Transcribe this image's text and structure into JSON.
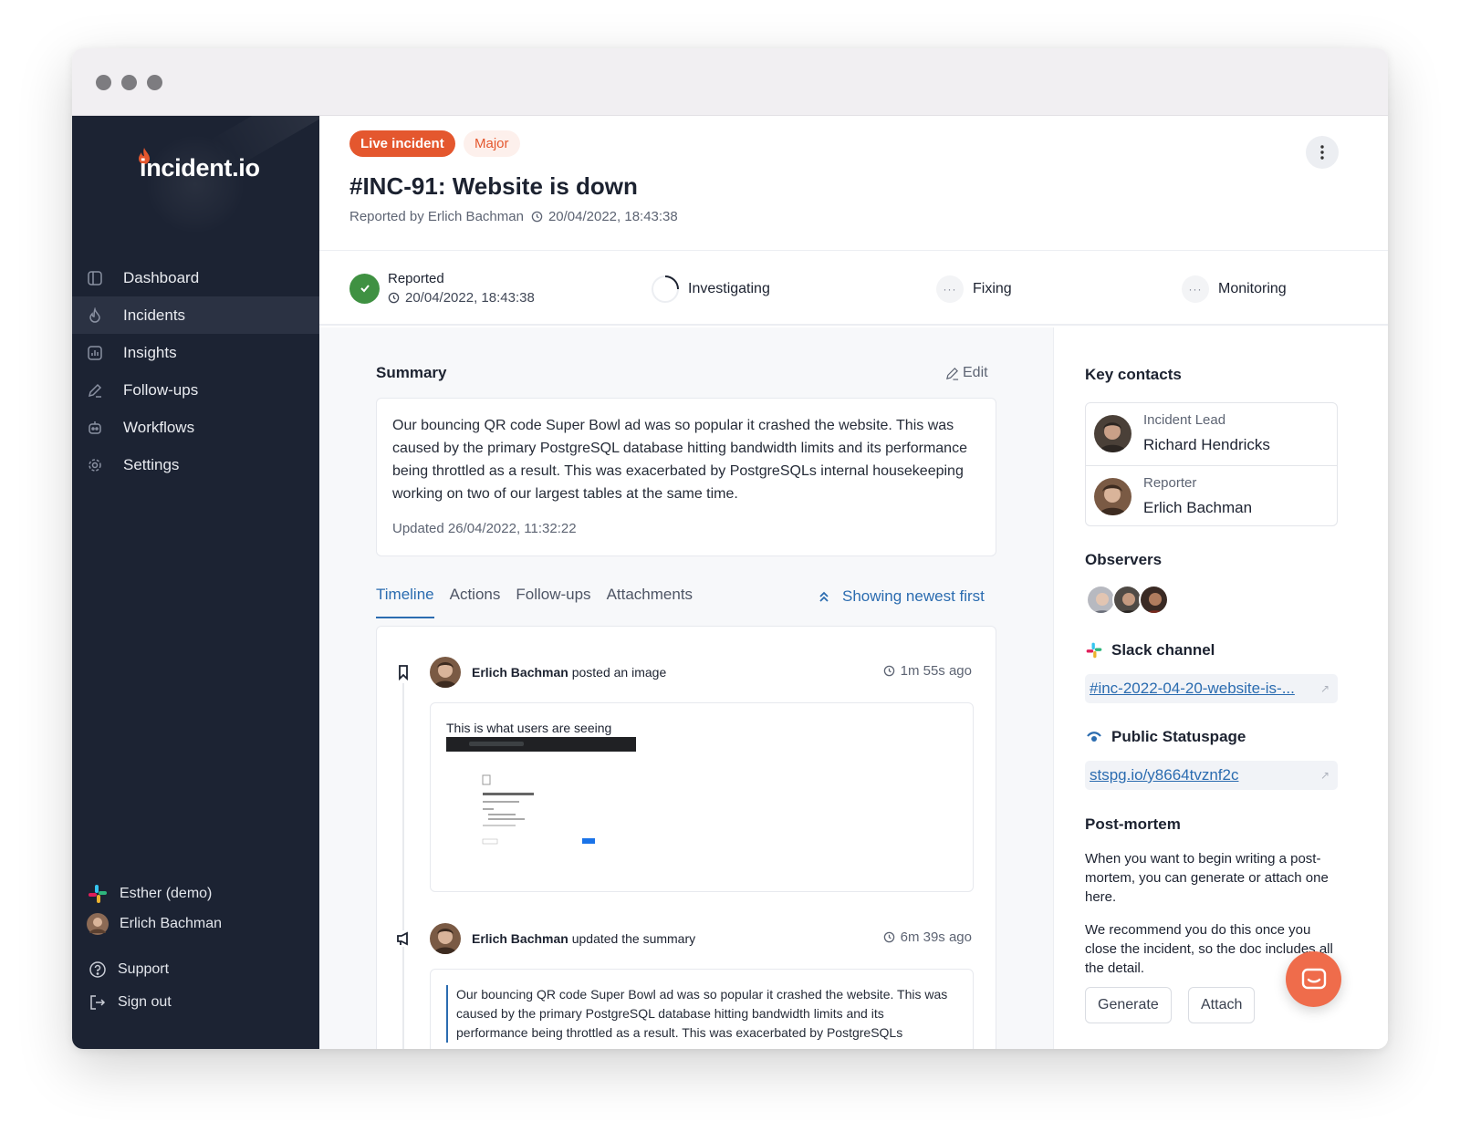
{
  "window": {
    "dots": [
      "close",
      "minimize",
      "maximize"
    ]
  },
  "brand": {
    "logo": "incident.io",
    "accent": "#e4572e",
    "sidebar_bg": "#1c2333",
    "link": "#2b6cb0"
  },
  "sidebar": {
    "items": [
      {
        "label": "Dashboard",
        "icon": "dashboard-icon"
      },
      {
        "label": "Incidents",
        "icon": "flame-icon",
        "active": true
      },
      {
        "label": "Insights",
        "icon": "chart-icon"
      },
      {
        "label": "Follow-ups",
        "icon": "pencil-icon"
      },
      {
        "label": "Workflows",
        "icon": "robot-icon"
      },
      {
        "label": "Settings",
        "icon": "gear-icon"
      }
    ],
    "workspace": "Esther (demo)",
    "user": "Erlich Bachman",
    "support": "Support",
    "sign_out": "Sign out"
  },
  "incident": {
    "status_badge": "Live incident",
    "severity_badge": "Major",
    "title": "#INC-91: Website is down",
    "reported_by": "Reported by Erlich Bachman",
    "reported_at": "20/04/2022, 18:43:38"
  },
  "status_steps": {
    "reported": {
      "label": "Reported",
      "time": "20/04/2022, 18:43:38"
    },
    "investigating": "Investigating",
    "fixing": "Fixing",
    "monitoring": "Monitoring",
    "dots": "···"
  },
  "summary": {
    "label": "Summary",
    "edit": "Edit",
    "text": "Our bouncing QR code Super Bowl ad was so popular it crashed the website. This was caused by the primary PostgreSQL database hitting bandwidth limits and its performance being throttled as a result. This was exacerbated by PostgreSQLs internal housekeeping working on two of our largest tables at the same time.",
    "updated": "Updated 26/04/2022, 11:32:22"
  },
  "tabs": [
    "Timeline",
    "Actions",
    "Follow-ups",
    "Attachments"
  ],
  "sort_label": "Showing newest first",
  "timeline": [
    {
      "author": "Erlich Bachman",
      "action": "posted an image",
      "time": "1m 55s ago",
      "caption": "This is what users are seeing"
    },
    {
      "author": "Erlich Bachman",
      "action": "updated the summary",
      "time": "6m 39s ago",
      "quote": "Our bouncing QR code Super Bowl ad was so popular it crashed the website. This was caused by the primary PostgreSQL database hitting bandwidth limits and its performance being throttled as a result. This was exacerbated by PostgreSQLs"
    }
  ],
  "right_panel": {
    "key_contacts": "Key contacts",
    "contacts": [
      {
        "role": "Incident Lead",
        "name": "Richard Hendricks"
      },
      {
        "role": "Reporter",
        "name": "Erlich Bachman"
      }
    ],
    "observers": "Observers",
    "slack_label": "Slack channel",
    "slack_link": "#inc-2022-04-20-website-is-...",
    "statuspage_label": "Public Statuspage",
    "statuspage_link": "stspg.io/y8664tvznf2c",
    "postmortem_label": "Post-mortem",
    "postmortem_text1": "When you want to begin writing a post-mortem, you can generate or attach one here.",
    "postmortem_text2": "We recommend you do this once you close the incident, so the doc includes all the detail.",
    "generate": "Generate",
    "attach": "Attach"
  }
}
